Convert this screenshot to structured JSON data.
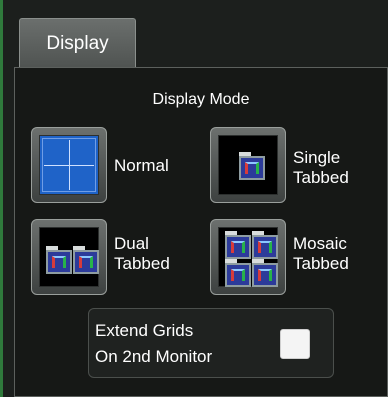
{
  "tab": {
    "label": "Display"
  },
  "panel": {
    "title": "Display Mode",
    "modes": [
      {
        "id": "normal",
        "label": "Normal",
        "icon": "normal-grid-icon"
      },
      {
        "id": "single_tabbed",
        "label": "Single\nTabbed",
        "icon": "single-tabbed-icon"
      },
      {
        "id": "dual_tabbed",
        "label": "Dual\nTabbed",
        "icon": "dual-tabbed-icon"
      },
      {
        "id": "mosaic_tabbed",
        "label": "Mosaic\nTabbed",
        "icon": "mosaic-tabbed-icon"
      }
    ],
    "extend_grids": {
      "label": "Extend Grids\nOn 2nd Monitor",
      "checked": false
    }
  },
  "colors": {
    "accent_grid_blue": "#1f63c8",
    "panel_bg": "#161816",
    "text": "#ffffff"
  }
}
